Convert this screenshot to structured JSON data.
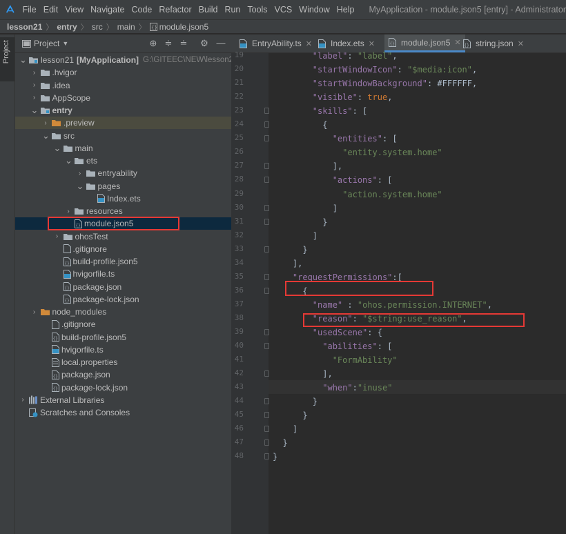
{
  "menubar": {
    "items": [
      "File",
      "Edit",
      "View",
      "Navigate",
      "Code",
      "Refactor",
      "Build",
      "Run",
      "Tools",
      "VCS",
      "Window",
      "Help"
    ],
    "title": "MyApplication - module.json5 [entry] - Administrator"
  },
  "breadcrumb": [
    "lesson21",
    "entry",
    "src",
    "main",
    "module.json5"
  ],
  "sidebar_tab": "Project",
  "project_panel": {
    "title": "Project"
  },
  "tree": [
    {
      "label": "lesson21",
      "bold_suffix": "[MyApplication]",
      "path": "G:\\GITEEC\\NEW\\lesson2",
      "indent": 0,
      "chev": "▼",
      "icon": "module"
    },
    {
      "label": ".hvigor",
      "indent": 1,
      "chev": "›",
      "icon": "folder"
    },
    {
      "label": ".idea",
      "indent": 1,
      "chev": "›",
      "icon": "folder"
    },
    {
      "label": "AppScope",
      "indent": 1,
      "chev": "›",
      "icon": "folder"
    },
    {
      "label": "entry",
      "indent": 1,
      "chev": "▼",
      "icon": "module",
      "bold": true
    },
    {
      "label": ".preview",
      "indent": 2,
      "chev": "›",
      "icon": "folder-orange",
      "highlight": true
    },
    {
      "label": "src",
      "indent": 2,
      "chev": "▼",
      "icon": "folder"
    },
    {
      "label": "main",
      "indent": 3,
      "chev": "▼",
      "icon": "folder"
    },
    {
      "label": "ets",
      "indent": 4,
      "chev": "▼",
      "icon": "folder"
    },
    {
      "label": "entryability",
      "indent": 5,
      "chev": "›",
      "icon": "folder"
    },
    {
      "label": "pages",
      "indent": 5,
      "chev": "▼",
      "icon": "folder"
    },
    {
      "label": "Index.ets",
      "indent": 6,
      "chev": "",
      "icon": "ets"
    },
    {
      "label": "resources",
      "indent": 4,
      "chev": "›",
      "icon": "folder"
    },
    {
      "label": "module.json5",
      "indent": 4,
      "chev": "",
      "icon": "json",
      "selected": true
    },
    {
      "label": "ohosTest",
      "indent": 3,
      "chev": "›",
      "icon": "folder"
    },
    {
      "label": ".gitignore",
      "indent": 3,
      "chev": "",
      "icon": "file"
    },
    {
      "label": "build-profile.json5",
      "indent": 3,
      "chev": "",
      "icon": "json"
    },
    {
      "label": "hvigorfile.ts",
      "indent": 3,
      "chev": "",
      "icon": "ts"
    },
    {
      "label": "package.json",
      "indent": 3,
      "chev": "",
      "icon": "json"
    },
    {
      "label": "package-lock.json",
      "indent": 3,
      "chev": "",
      "icon": "json"
    },
    {
      "label": "node_modules",
      "indent": 1,
      "chev": "›",
      "icon": "folder-orange"
    },
    {
      "label": ".gitignore",
      "indent": 2,
      "chev": "",
      "icon": "file"
    },
    {
      "label": "build-profile.json5",
      "indent": 2,
      "chev": "",
      "icon": "json"
    },
    {
      "label": "hvigorfile.ts",
      "indent": 2,
      "chev": "",
      "icon": "ts"
    },
    {
      "label": "local.properties",
      "indent": 2,
      "chev": "",
      "icon": "props"
    },
    {
      "label": "package.json",
      "indent": 2,
      "chev": "",
      "icon": "json"
    },
    {
      "label": "package-lock.json",
      "indent": 2,
      "chev": "",
      "icon": "json"
    },
    {
      "label": "External Libraries",
      "indent": 0,
      "chev": "›",
      "icon": "libs"
    },
    {
      "label": "Scratches and Consoles",
      "indent": 0,
      "chev": "",
      "icon": "scratch"
    }
  ],
  "tabs": [
    {
      "label": "EntryAbility.ts",
      "icon": "ts"
    },
    {
      "label": "Index.ets",
      "icon": "ets"
    },
    {
      "label": "module.json5",
      "icon": "json",
      "active": true
    },
    {
      "label": "string.json",
      "icon": "json"
    }
  ],
  "code_lines": [
    {
      "n": "19",
      "html": "        <span class='k'>\"label\"</span>: <span class='s'>\"label\"</span>,"
    },
    {
      "n": "20",
      "html": "        <span class='k'>\"startWindowIcon\"</span>: <span class='s'>\"$media:icon\"</span>,"
    },
    {
      "n": "21",
      "html": "        <span class='k'>\"startWindowBackground\"</span>: <span class='n'>#FFFFFF</span>,"
    },
    {
      "n": "22",
      "html": "        <span class='k'>\"visible\"</span>: <span class='p'>true</span>,"
    },
    {
      "n": "23",
      "html": "        <span class='k'>\"skills\"</span>: ["
    },
    {
      "n": "24",
      "html": "          {"
    },
    {
      "n": "25",
      "html": "            <span class='k'>\"entities\"</span>: ["
    },
    {
      "n": "26",
      "html": "              <span class='s'>\"entity.system.home\"</span>"
    },
    {
      "n": "27",
      "html": "            ],"
    },
    {
      "n": "28",
      "html": "            <span class='k'>\"actions\"</span>: ["
    },
    {
      "n": "29",
      "html": "              <span class='s'>\"action.system.home\"</span>"
    },
    {
      "n": "30",
      "html": "            ]"
    },
    {
      "n": "31",
      "html": "          }"
    },
    {
      "n": "32",
      "html": "        ]"
    },
    {
      "n": "33",
      "html": "      }"
    },
    {
      "n": "34",
      "html": "    ],"
    },
    {
      "n": "35",
      "html": "    <span class='k'>\"requestPermissions\"</span>:["
    },
    {
      "n": "36",
      "html": "      {"
    },
    {
      "n": "37",
      "html": "        <span class='k'>\"name\"</span> : <span class='s'>\"ohos.permission.INTERNET\"</span>,"
    },
    {
      "n": "38",
      "html": "        <span class='k'>\"reason\"</span>: <span class='s'>\"$string:use_reason\"</span>,"
    },
    {
      "n": "39",
      "html": "        <span class='k'>\"usedScene\"</span>: {"
    },
    {
      "n": "40",
      "html": "          <span class='k'>\"abilities\"</span>: ["
    },
    {
      "n": "41",
      "html": "            <span class='s'>\"FormAbility\"</span>"
    },
    {
      "n": "42",
      "html": "          ],"
    },
    {
      "n": "43",
      "html": "          <span class='k'>\"when\"</span>:<span class='s'>\"inuse\"</span>"
    },
    {
      "n": "44",
      "html": "        }"
    },
    {
      "n": "45",
      "html": "      }"
    },
    {
      "n": "46",
      "html": "    ]"
    },
    {
      "n": "47",
      "html": "  }"
    },
    {
      "n": "48",
      "html": "}"
    }
  ],
  "colors": {
    "annotation": "#e53935",
    "accent": "#4a88c7",
    "selection": "#0d293e"
  }
}
